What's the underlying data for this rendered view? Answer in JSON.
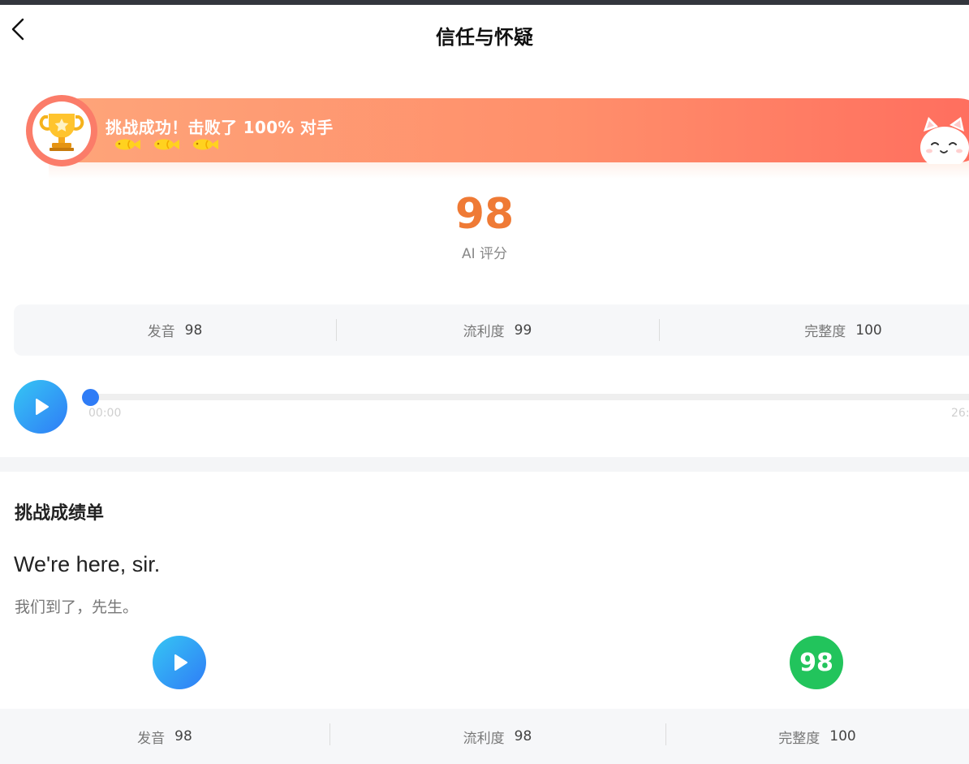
{
  "header": {
    "title": "信任与怀疑"
  },
  "banner": {
    "text": "挑战成功！击败了 100% 对手",
    "fish_count": 3
  },
  "score": {
    "value": "98",
    "label": "AI 评分"
  },
  "overall_metrics": [
    {
      "label": "发音",
      "value": "98"
    },
    {
      "label": "流利度",
      "value": "99"
    },
    {
      "label": "完整度",
      "value": "100"
    }
  ],
  "player": {
    "start_time": "00:00",
    "end_time": "26:",
    "progress": 0
  },
  "report": {
    "title": "挑战成绩单",
    "sentences": [
      {
        "english": "We're here, sir.",
        "chinese": "我们到了，先生。",
        "score": "98",
        "metrics": [
          {
            "label": "发音",
            "value": "98"
          },
          {
            "label": "流利度",
            "value": "98"
          },
          {
            "label": "完整度",
            "value": "100"
          }
        ]
      }
    ]
  },
  "colors": {
    "accent_orange": "#ef7a35",
    "play_blue": "#2f7cf6",
    "score_green": "#22c45c",
    "banner_start": "#fea57a",
    "banner_end": "#ff6d5e"
  }
}
